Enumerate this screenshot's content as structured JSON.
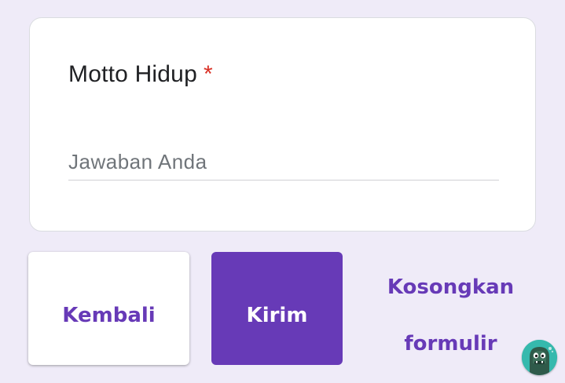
{
  "question": {
    "title": "Motto Hidup",
    "required_marker": "*",
    "answer_placeholder": "Jawaban Anda",
    "answer_value": ""
  },
  "actions": {
    "back_label": "Kembali",
    "submit_label": "Kirim",
    "clear_label_line1": "Kosongkan",
    "clear_label_line2": "formulir"
  },
  "avatar": {
    "icon": "monster-avatar-icon"
  },
  "colors": {
    "page_background": "#efebf8",
    "accent": "#673ab7",
    "required": "#d93025"
  }
}
